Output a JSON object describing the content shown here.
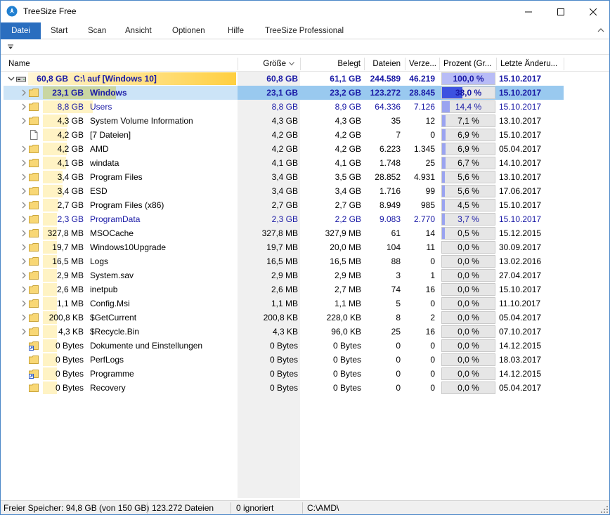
{
  "window": {
    "title": "TreeSize Free",
    "icon": "treesize-app-icon",
    "controls": {
      "minimize": "minimize-icon",
      "maximize": "maximize-icon",
      "close": "close-icon"
    }
  },
  "menu": {
    "items": [
      "Datei",
      "Start",
      "Scan",
      "Ansicht",
      "Optionen",
      "Hilfe",
      "TreeSize Professional"
    ],
    "active_index": 0,
    "accent_color": "#2a6ebf"
  },
  "columns": {
    "name": "Name",
    "size": "Größe",
    "allocated": "Belegt",
    "files": "Dateien",
    "folders": "Verze...",
    "percent": "Prozent (Gr...",
    "modified": "Letzte Änderu..."
  },
  "rows": [
    {
      "type": "drive",
      "bar": 1.0,
      "expanded": true,
      "size_label": "60,8 GB",
      "name": "C:\\  auf  [Windows 10]",
      "size": "60,8 GB",
      "allocated": "61,1 GB",
      "files": "244.589",
      "folders": "46.219",
      "percent": "100,0 %",
      "pct": 1.0,
      "date": "15.10.2017",
      "style": "root"
    },
    {
      "type": "folder",
      "bar": 0.38,
      "expanded": false,
      "size_label": "23,1 GB",
      "name": "Windows",
      "size": "23,1 GB",
      "allocated": "23,2 GB",
      "files": "123.272",
      "folders": "28.845",
      "percent": "38,0 %",
      "pct": 0.38,
      "date": "15.10.2017",
      "style": "selected"
    },
    {
      "type": "folder",
      "bar": 0.144,
      "expanded": false,
      "size_label": "8,8 GB",
      "name": "Users",
      "size": "8,8 GB",
      "allocated": "8,9 GB",
      "files": "64.336",
      "folders": "7.126",
      "percent": "14,4 %",
      "pct": 0.144,
      "date": "15.10.2017",
      "style": "blue"
    },
    {
      "type": "folder",
      "bar": 0.071,
      "expanded": false,
      "size_label": "4,3 GB",
      "name": "System Volume Information",
      "size": "4,3 GB",
      "allocated": "4,3 GB",
      "files": "35",
      "folders": "12",
      "percent": "7,1 %",
      "pct": 0.071,
      "date": "13.10.2017",
      "style": "normal"
    },
    {
      "type": "file",
      "bar": 0.069,
      "expanded": null,
      "size_label": "4,2 GB",
      "name": "[7 Dateien]",
      "size": "4,2 GB",
      "allocated": "4,2 GB",
      "files": "7",
      "folders": "0",
      "percent": "6,9 %",
      "pct": 0.069,
      "date": "15.10.2017",
      "style": "normal"
    },
    {
      "type": "folder",
      "bar": 0.069,
      "expanded": false,
      "size_label": "4,2 GB",
      "name": "AMD",
      "size": "4,2 GB",
      "allocated": "4,2 GB",
      "files": "6.223",
      "folders": "1.345",
      "percent": "6,9 %",
      "pct": 0.069,
      "date": "05.04.2017",
      "style": "normal"
    },
    {
      "type": "folder",
      "bar": 0.067,
      "expanded": false,
      "size_label": "4,1 GB",
      "name": "windata",
      "size": "4,1 GB",
      "allocated": "4,1 GB",
      "files": "1.748",
      "folders": "25",
      "percent": "6,7 %",
      "pct": 0.067,
      "date": "14.10.2017",
      "style": "normal"
    },
    {
      "type": "folder",
      "bar": 0.056,
      "expanded": false,
      "size_label": "3,4 GB",
      "name": "Program Files",
      "size": "3,4 GB",
      "allocated": "3,5 GB",
      "files": "28.852",
      "folders": "4.931",
      "percent": "5,6 %",
      "pct": 0.056,
      "date": "13.10.2017",
      "style": "normal"
    },
    {
      "type": "folder",
      "bar": 0.056,
      "expanded": false,
      "size_label": "3,4 GB",
      "name": "ESD",
      "size": "3,4 GB",
      "allocated": "3,4 GB",
      "files": "1.716",
      "folders": "99",
      "percent": "5,6 %",
      "pct": 0.056,
      "date": "17.06.2017",
      "style": "normal"
    },
    {
      "type": "folder",
      "bar": 0.045,
      "expanded": false,
      "size_label": "2,7 GB",
      "name": "Program Files (x86)",
      "size": "2,7 GB",
      "allocated": "2,7 GB",
      "files": "8.949",
      "folders": "985",
      "percent": "4,5 %",
      "pct": 0.045,
      "date": "15.10.2017",
      "style": "normal"
    },
    {
      "type": "folder",
      "bar": 0.037,
      "expanded": false,
      "size_label": "2,3 GB",
      "name": "ProgramData",
      "size": "2,3 GB",
      "allocated": "2,2 GB",
      "files": "9.083",
      "folders": "2.770",
      "percent": "3,7 %",
      "pct": 0.037,
      "date": "15.10.2017",
      "style": "blue"
    },
    {
      "type": "folder",
      "bar": 0.005,
      "expanded": false,
      "size_label": "327,8 MB",
      "name": "MSOCache",
      "size": "327,8 MB",
      "allocated": "327,9 MB",
      "files": "61",
      "folders": "14",
      "percent": "0,5 %",
      "pct": 0.005,
      "date": "15.12.2015",
      "style": "normal"
    },
    {
      "type": "folder",
      "bar": 0.0,
      "expanded": false,
      "size_label": "19,7 MB",
      "name": "Windows10Upgrade",
      "size": "19,7 MB",
      "allocated": "20,0 MB",
      "files": "104",
      "folders": "11",
      "percent": "0,0 %",
      "pct": 0.0,
      "date": "30.09.2017",
      "style": "normal"
    },
    {
      "type": "folder",
      "bar": 0.0,
      "expanded": false,
      "size_label": "16,5 MB",
      "name": "Logs",
      "size": "16,5 MB",
      "allocated": "16,5 MB",
      "files": "88",
      "folders": "0",
      "percent": "0,0 %",
      "pct": 0.0,
      "date": "13.02.2016",
      "style": "normal"
    },
    {
      "type": "folder",
      "bar": 0.0,
      "expanded": false,
      "size_label": "2,9 MB",
      "name": "System.sav",
      "size": "2,9 MB",
      "allocated": "2,9 MB",
      "files": "3",
      "folders": "1",
      "percent": "0,0 %",
      "pct": 0.0,
      "date": "27.04.2017",
      "style": "normal"
    },
    {
      "type": "folder",
      "bar": 0.0,
      "expanded": false,
      "size_label": "2,6 MB",
      "name": "inetpub",
      "size": "2,6 MB",
      "allocated": "2,7 MB",
      "files": "74",
      "folders": "16",
      "percent": "0,0 %",
      "pct": 0.0,
      "date": "15.10.2017",
      "style": "normal"
    },
    {
      "type": "folder",
      "bar": 0.0,
      "expanded": false,
      "size_label": "1,1 MB",
      "name": "Config.Msi",
      "size": "1,1 MB",
      "allocated": "1,1 MB",
      "files": "5",
      "folders": "0",
      "percent": "0,0 %",
      "pct": 0.0,
      "date": "11.10.2017",
      "style": "normal"
    },
    {
      "type": "folder",
      "bar": 0.0,
      "expanded": false,
      "size_label": "200,8 KB",
      "name": "$GetCurrent",
      "size": "200,8 KB",
      "allocated": "228,0 KB",
      "files": "8",
      "folders": "2",
      "percent": "0,0 %",
      "pct": 0.0,
      "date": "05.04.2017",
      "style": "normal"
    },
    {
      "type": "folder",
      "bar": 0.0,
      "expanded": false,
      "size_label": "4,3 KB",
      "name": "$Recycle.Bin",
      "size": "4,3 KB",
      "allocated": "96,0 KB",
      "files": "25",
      "folders": "16",
      "percent": "0,0 %",
      "pct": 0.0,
      "date": "07.10.2017",
      "style": "normal"
    },
    {
      "type": "link",
      "bar": 0.0,
      "expanded": null,
      "size_label": "0 Bytes",
      "name": "Dokumente und Einstellungen",
      "size": "0 Bytes",
      "allocated": "0 Bytes",
      "files": "0",
      "folders": "0",
      "percent": "0,0 %",
      "pct": 0.0,
      "date": "14.12.2015",
      "style": "normal"
    },
    {
      "type": "folder",
      "bar": 0.0,
      "expanded": null,
      "size_label": "0 Bytes",
      "name": "PerfLogs",
      "size": "0 Bytes",
      "allocated": "0 Bytes",
      "files": "0",
      "folders": "0",
      "percent": "0,0 %",
      "pct": 0.0,
      "date": "18.03.2017",
      "style": "normal"
    },
    {
      "type": "link",
      "bar": 0.0,
      "expanded": null,
      "size_label": "0 Bytes",
      "name": "Programme",
      "size": "0 Bytes",
      "allocated": "0 Bytes",
      "files": "0",
      "folders": "0",
      "percent": "0,0 %",
      "pct": 0.0,
      "date": "14.12.2015",
      "style": "normal"
    },
    {
      "type": "folder",
      "bar": 0.0,
      "expanded": null,
      "size_label": "0 Bytes",
      "name": "Recovery",
      "size": "0 Bytes",
      "allocated": "0 Bytes",
      "files": "0",
      "folders": "0",
      "percent": "0,0 %",
      "pct": 0.0,
      "date": "05.04.2017",
      "style": "normal"
    }
  ],
  "colors": {
    "size_bar": "#fff3c4",
    "root_bar": "#ffcf40",
    "selected_bar": "#c9d6a2",
    "blue_text": "#1a1aa6",
    "percent_fill": "#9aa3f0",
    "percent_fill_selected": "#3d52e0"
  },
  "status": {
    "free_space": "Freier Speicher: 94,8 GB  (von 150 GB)",
    "files": "123.272  Dateien",
    "ignored": "0 ignoriert",
    "path": "C:\\AMD\\"
  }
}
